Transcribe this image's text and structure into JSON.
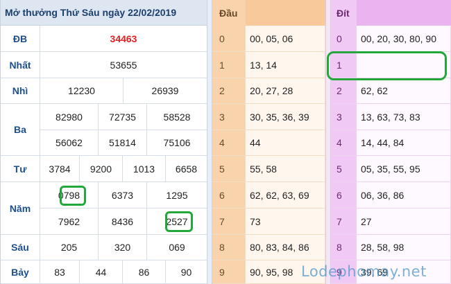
{
  "left": {
    "title": "Mở thưởng Thứ Sáu ngày 22/02/2019",
    "rows": [
      {
        "label": "ĐB",
        "values": [
          "34463"
        ]
      },
      {
        "label": "Nhất",
        "values": [
          "53655"
        ]
      },
      {
        "label": "Nhì",
        "values": [
          "12230",
          "26939"
        ]
      },
      {
        "label": "Ba",
        "values": [
          "82980",
          "72735",
          "58528",
          "56062",
          "51814",
          "75106"
        ]
      },
      {
        "label": "Tư",
        "values": [
          "3784",
          "9200",
          "1013",
          "6658"
        ]
      },
      {
        "label": "Năm",
        "values": [
          "0798",
          "6373",
          "1295",
          "7962",
          "8436",
          "2527"
        ]
      },
      {
        "label": "Sáu",
        "values": [
          "205",
          "320",
          "069"
        ]
      },
      {
        "label": "Bảy",
        "values": [
          "83",
          "44",
          "86",
          "90"
        ]
      }
    ]
  },
  "dau": {
    "header": "Đầu",
    "rows": [
      {
        "digit": "0",
        "list": "00, 05, 06"
      },
      {
        "digit": "1",
        "list": "13, 14"
      },
      {
        "digit": "2",
        "list": "20, 27, 28"
      },
      {
        "digit": "3",
        "list": "30, 35, 36, 39"
      },
      {
        "digit": "4",
        "list": "44"
      },
      {
        "digit": "5",
        "list": "55, 58"
      },
      {
        "digit": "6",
        "list": "62, 62, 63, 69"
      },
      {
        "digit": "7",
        "list": "73"
      },
      {
        "digit": "8",
        "list": "80, 83, 84, 86"
      },
      {
        "digit": "9",
        "list": "90, 95, 98"
      }
    ]
  },
  "dit": {
    "header": "Đít",
    "rows": [
      {
        "digit": "0",
        "list": "00, 20, 30, 80, 90"
      },
      {
        "digit": "1",
        "list": ""
      },
      {
        "digit": "2",
        "list": "62, 62"
      },
      {
        "digit": "3",
        "list": "13, 63, 73, 83"
      },
      {
        "digit": "4",
        "list": "14, 44, 84"
      },
      {
        "digit": "5",
        "list": "05, 35, 55, 95"
      },
      {
        "digit": "6",
        "list": "06, 36, 86"
      },
      {
        "digit": "7",
        "list": "27"
      },
      {
        "digit": "8",
        "list": "28, 58, 98"
      },
      {
        "digit": "9",
        "list": "39, 69"
      }
    ]
  },
  "watermark": "Lodephomay.net",
  "colors": {
    "highlight_ring": "#22a83a",
    "special_prize": "#e02020",
    "dau_header": "#f8c99a",
    "dit_header": "#e9b4f0",
    "left_header": "#dde6f1"
  }
}
